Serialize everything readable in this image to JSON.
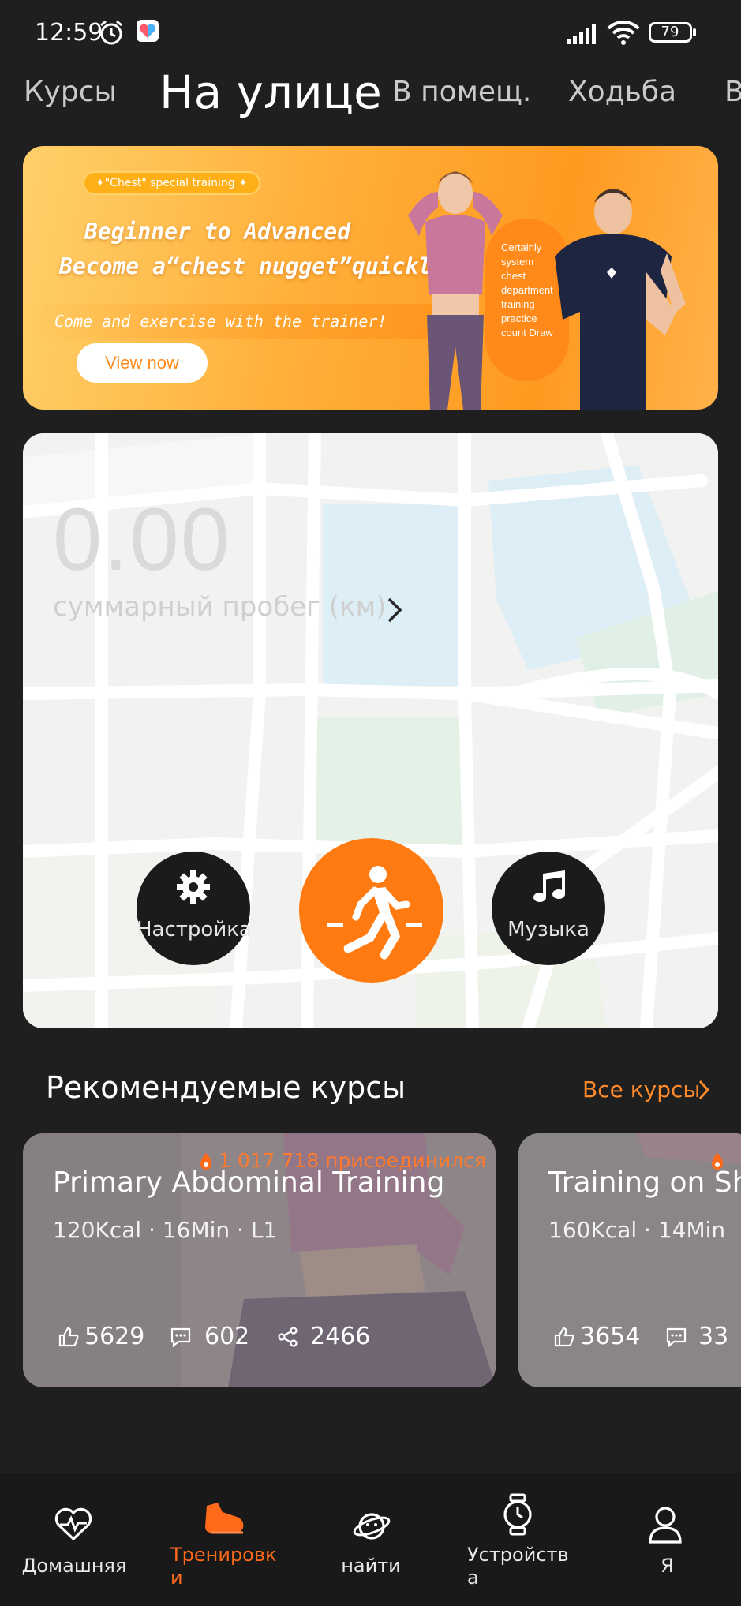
{
  "status_bar": {
    "time": "12:59",
    "battery": "79"
  },
  "tabs": [
    {
      "label": "Курсы",
      "active": false
    },
    {
      "label": "На улице",
      "active": true
    },
    {
      "label": "В помещ.",
      "active": false
    },
    {
      "label": "Ходьба",
      "active": false
    },
    {
      "label": "В",
      "active": false
    }
  ],
  "banner": {
    "pill": "✦\"Chest\" special training ✦",
    "line1": "Beginner to Advanced",
    "line2": "Become a“chest nugget”quickly",
    "line3": "Come and exercise with the trainer!",
    "button": "View now",
    "bubble": "Certainly system chest department training practice count Draw"
  },
  "map": {
    "total_value": "0.00",
    "total_label": "суммарный пробег (км)",
    "settings_label": "Настройка",
    "music_label": "Музыка",
    "start_icon": "running-person-icon"
  },
  "recommended": {
    "title": "Рекомендуемые курсы",
    "all_link": "Все курсы",
    "courses": [
      {
        "joined": "1 017 718 присоединился",
        "title": "Primary Abdominal Training",
        "meta": "120Kcal · 16Min · L1",
        "likes": "5629",
        "comments": "602",
        "shares": "2466"
      },
      {
        "title": "Training on Sh",
        "meta": "160Kcal · 14Min",
        "likes": "3654",
        "comments": "33"
      }
    ]
  },
  "bottom_nav": [
    {
      "label": "Домашняя",
      "icon": "heart-pulse-icon",
      "active": false
    },
    {
      "label": "Тренировк\nи",
      "icon": "shoe-icon",
      "active": true
    },
    {
      "label": "найти",
      "icon": "planet-icon",
      "active": false
    },
    {
      "label": "Устройств\nа",
      "icon": "watch-icon",
      "active": false
    },
    {
      "label": "Я",
      "icon": "person-icon",
      "active": false
    }
  ],
  "colors": {
    "accent": "#ff7a10",
    "background": "#1f1f1f"
  }
}
